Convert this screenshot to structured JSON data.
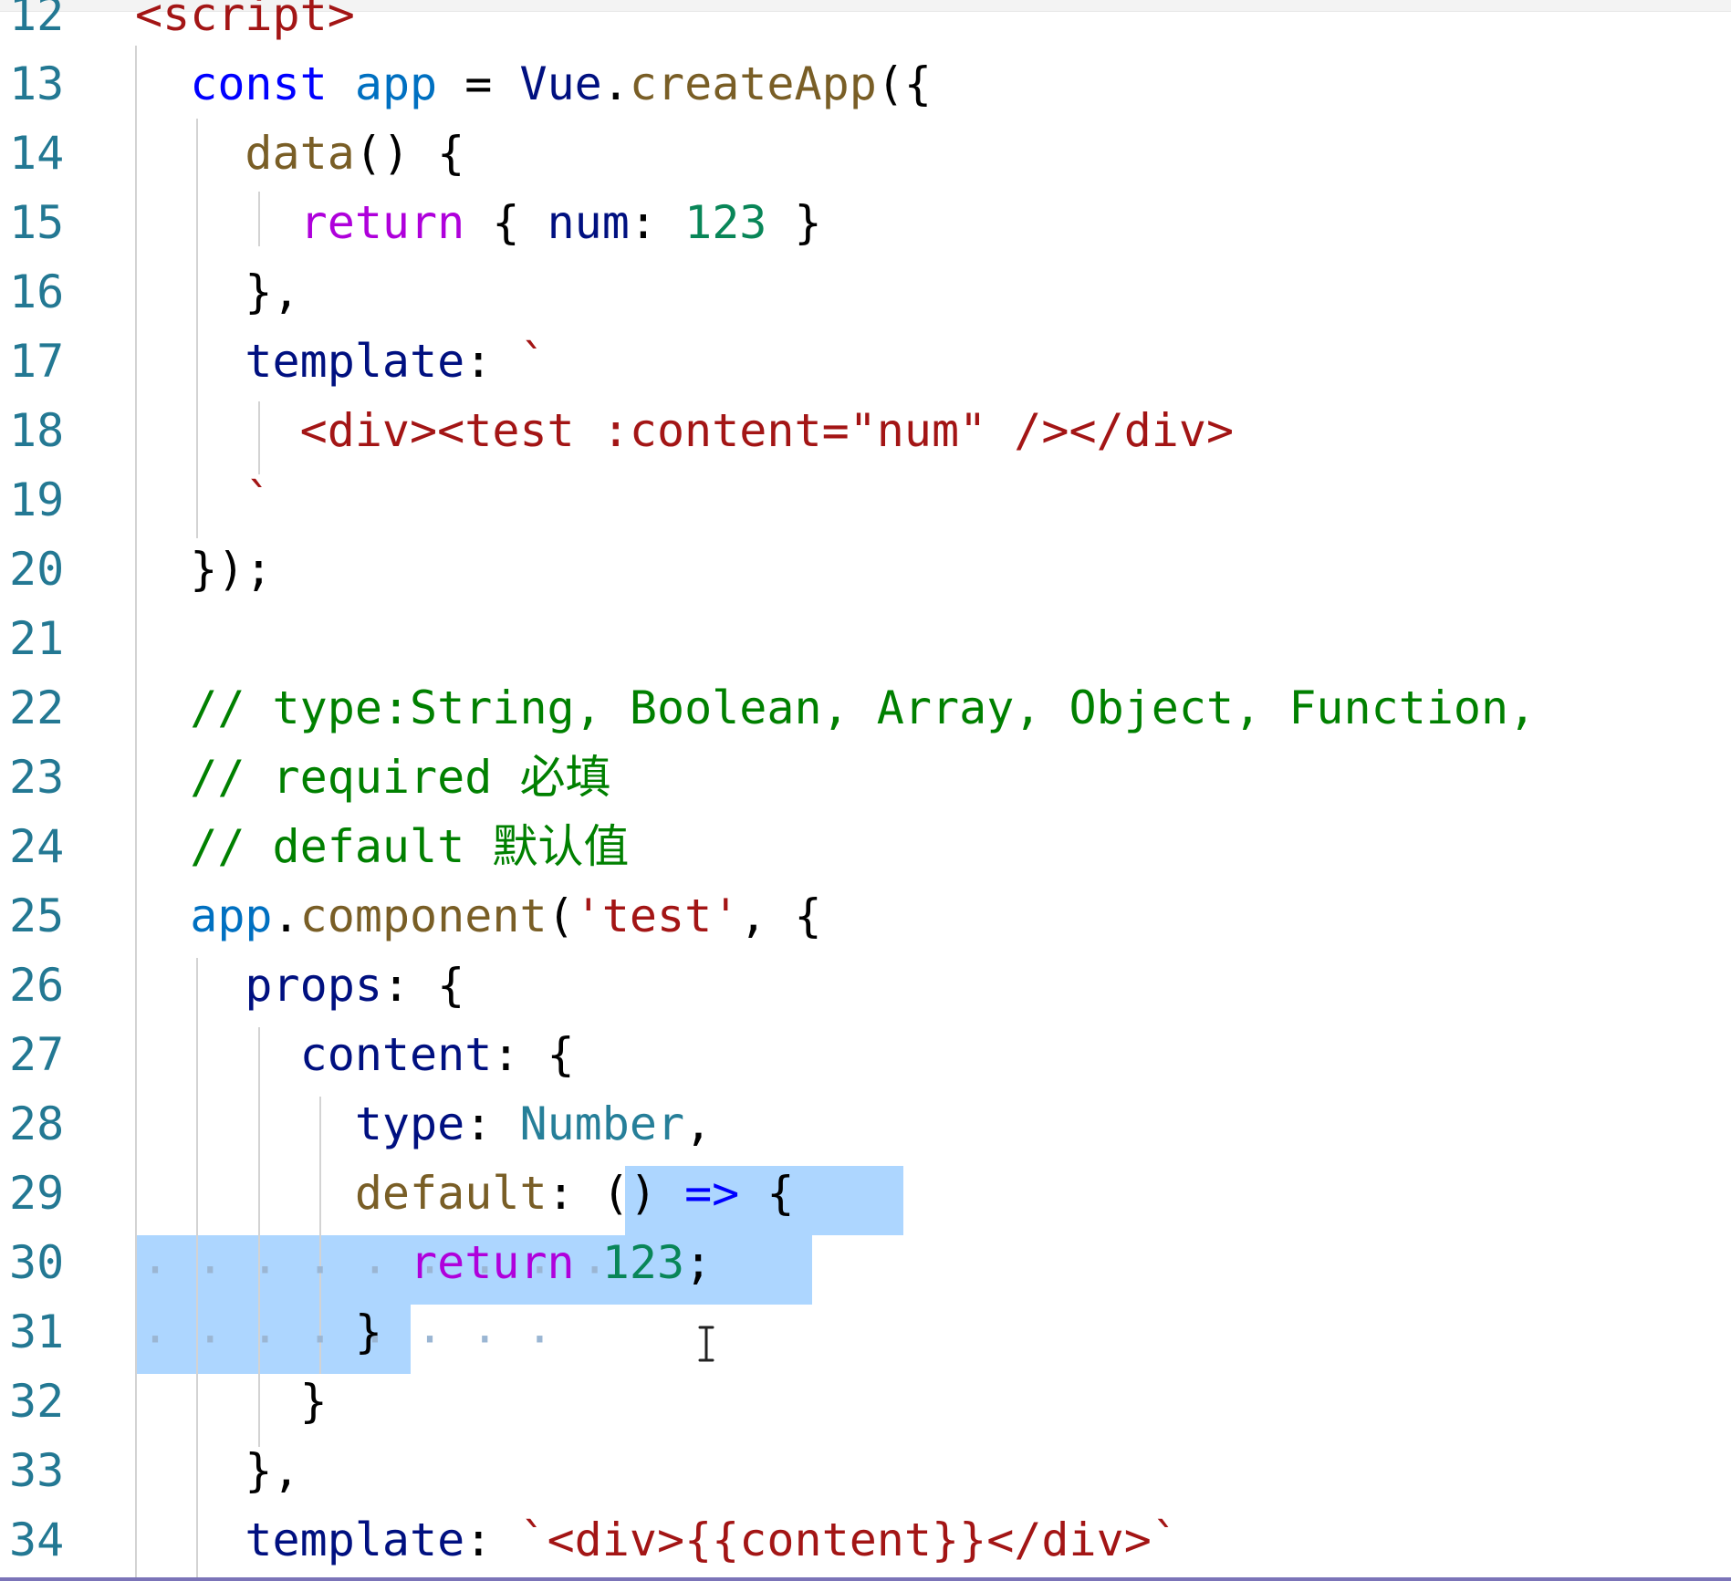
{
  "editor": {
    "language": "javascript",
    "colors": {
      "line_number": "#237893",
      "keyword": "#0000ff",
      "control": "#af00db",
      "function": "#795e26",
      "variable": "#001080",
      "variable_light": "#0070c1",
      "type": "#267f99",
      "string": "#a31515",
      "number": "#098658",
      "comment": "#008000",
      "selection": "#add6ff"
    },
    "lines": [
      {
        "num": "12",
        "tokens": [
          {
            "t": "<script>",
            "c": "string"
          }
        ]
      },
      {
        "num": "13",
        "tokens": [
          {
            "t": "  ",
            "c": "plain"
          },
          {
            "t": "const",
            "c": "keyword"
          },
          {
            "t": " ",
            "c": "plain"
          },
          {
            "t": "app",
            "c": "variable_light"
          },
          {
            "t": " = ",
            "c": "plain"
          },
          {
            "t": "Vue",
            "c": "variable"
          },
          {
            "t": ".",
            "c": "plain"
          },
          {
            "t": "createApp",
            "c": "function"
          },
          {
            "t": "({",
            "c": "plain"
          }
        ]
      },
      {
        "num": "14",
        "tokens": [
          {
            "t": "    ",
            "c": "plain"
          },
          {
            "t": "data",
            "c": "function"
          },
          {
            "t": "() {",
            "c": "plain"
          }
        ]
      },
      {
        "num": "15",
        "tokens": [
          {
            "t": "      ",
            "c": "plain"
          },
          {
            "t": "return",
            "c": "control"
          },
          {
            "t": " { ",
            "c": "plain"
          },
          {
            "t": "num",
            "c": "variable"
          },
          {
            "t": ": ",
            "c": "plain"
          },
          {
            "t": "123",
            "c": "number"
          },
          {
            "t": " }",
            "c": "plain"
          }
        ]
      },
      {
        "num": "16",
        "tokens": [
          {
            "t": "    },",
            "c": "plain"
          }
        ]
      },
      {
        "num": "17",
        "tokens": [
          {
            "t": "    ",
            "c": "plain"
          },
          {
            "t": "template",
            "c": "variable"
          },
          {
            "t": ": ",
            "c": "plain"
          },
          {
            "t": "`",
            "c": "string"
          }
        ]
      },
      {
        "num": "18",
        "tokens": [
          {
            "t": "      ",
            "c": "plain"
          },
          {
            "t": "<div><test :content=\"num\" /></div>",
            "c": "string"
          }
        ]
      },
      {
        "num": "19",
        "tokens": [
          {
            "t": "    ",
            "c": "plain"
          },
          {
            "t": "`",
            "c": "string"
          }
        ]
      },
      {
        "num": "20",
        "tokens": [
          {
            "t": "  });",
            "c": "plain"
          }
        ]
      },
      {
        "num": "21",
        "tokens": []
      },
      {
        "num": "22",
        "tokens": [
          {
            "t": "  ",
            "c": "plain"
          },
          {
            "t": "// type:String, Boolean, Array, Object, Function,",
            "c": "comment"
          }
        ]
      },
      {
        "num": "23",
        "tokens": [
          {
            "t": "  ",
            "c": "plain"
          },
          {
            "t": "// required 必填",
            "c": "comment"
          }
        ]
      },
      {
        "num": "24",
        "tokens": [
          {
            "t": "  ",
            "c": "plain"
          },
          {
            "t": "// default 默认值",
            "c": "comment"
          }
        ]
      },
      {
        "num": "25",
        "tokens": [
          {
            "t": "  ",
            "c": "plain"
          },
          {
            "t": "app",
            "c": "variable_light"
          },
          {
            "t": ".",
            "c": "plain"
          },
          {
            "t": "component",
            "c": "function"
          },
          {
            "t": "(",
            "c": "plain"
          },
          {
            "t": "'test'",
            "c": "string"
          },
          {
            "t": ", {",
            "c": "plain"
          }
        ]
      },
      {
        "num": "26",
        "tokens": [
          {
            "t": "    ",
            "c": "plain"
          },
          {
            "t": "props",
            "c": "variable"
          },
          {
            "t": ": {",
            "c": "plain"
          }
        ]
      },
      {
        "num": "27",
        "tokens": [
          {
            "t": "      ",
            "c": "plain"
          },
          {
            "t": "content",
            "c": "variable"
          },
          {
            "t": ": {",
            "c": "plain"
          }
        ]
      },
      {
        "num": "28",
        "tokens": [
          {
            "t": "        ",
            "c": "plain"
          },
          {
            "t": "type",
            "c": "variable"
          },
          {
            "t": ": ",
            "c": "plain"
          },
          {
            "t": "Number",
            "c": "type"
          },
          {
            "t": ",",
            "c": "plain"
          }
        ]
      },
      {
        "num": "29",
        "tokens": [
          {
            "t": "        ",
            "c": "plain"
          },
          {
            "t": "default",
            "c": "function"
          },
          {
            "t": ": () ",
            "c": "plain"
          },
          {
            "t": "=>",
            "c": "keyword"
          },
          {
            "t": " {",
            "c": "plain"
          }
        ]
      },
      {
        "num": "30",
        "tokens": [
          {
            "t": "          ",
            "c": "plain"
          },
          {
            "t": "return",
            "c": "control"
          },
          {
            "t": " ",
            "c": "plain"
          },
          {
            "t": "123",
            "c": "number"
          },
          {
            "t": ";",
            "c": "plain"
          }
        ]
      },
      {
        "num": "31",
        "tokens": [
          {
            "t": "        }",
            "c": "plain"
          }
        ]
      },
      {
        "num": "32",
        "tokens": [
          {
            "t": "      }",
            "c": "plain"
          }
        ]
      },
      {
        "num": "33",
        "tokens": [
          {
            "t": "    },",
            "c": "plain"
          }
        ]
      },
      {
        "num": "34",
        "tokens": [
          {
            "t": "    ",
            "c": "plain"
          },
          {
            "t": "template",
            "c": "variable"
          },
          {
            "t": ": ",
            "c": "plain"
          },
          {
            "t": "`<div>{{content}}</div>`",
            "c": "string"
          }
        ]
      }
    ],
    "selection_whitespace": {
      "line_30": "· · · · · · · · · ",
      "line_31": "· · · · · · · · "
    },
    "cursor_icon": "text-cursor-icon"
  }
}
